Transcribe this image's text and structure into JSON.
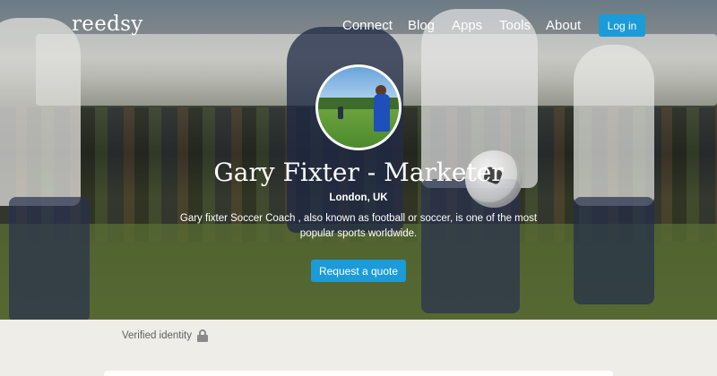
{
  "brand": {
    "logo": "reedsy"
  },
  "nav": {
    "items": [
      "Connect",
      "Blog",
      "Apps",
      "Tools",
      "About"
    ],
    "login_label": "Log in"
  },
  "profile": {
    "name_title": "Gary Fixter - Marketer",
    "location": "London, UK",
    "description": "Gary fixter Soccer Coach , also known as football or soccer, is one of the most popular sports worldwide.",
    "quote_label": "Request a quote",
    "avatar_alt": "Profile photo"
  },
  "verification": {
    "label": "Verified identity",
    "icon": "lock-icon"
  },
  "colors": {
    "accent": "#1b9bd8",
    "page_bg": "#efede8"
  }
}
